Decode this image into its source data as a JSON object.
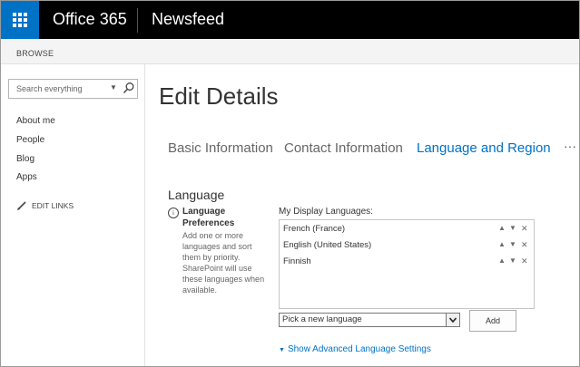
{
  "suite": {
    "title": "Office 365",
    "app": "Newsfeed",
    "accent": "#0072c6",
    "bar_color": "#000000"
  },
  "ribbon": {
    "browse_tab": "BROWSE"
  },
  "leftnav": {
    "search_placeholder": "Search everything",
    "search_caret": "▼",
    "items": [
      {
        "label": "About me"
      },
      {
        "label": "People"
      },
      {
        "label": "Blog"
      },
      {
        "label": "Apps"
      }
    ],
    "edit_links": "EDIT LINKS"
  },
  "main": {
    "title": "Edit Details",
    "tabs": [
      {
        "label": "Basic Information",
        "active": false
      },
      {
        "label": "Contact Information",
        "active": false
      },
      {
        "label": "Language and Region",
        "active": true
      }
    ],
    "tab_more": "···",
    "section": {
      "title": "Language",
      "info_icon": "i",
      "pref_title": "Language Preferences",
      "pref_desc": "Add one or more languages and sort them by priority. SharePoint will use these languages when available."
    },
    "display_languages": {
      "label": "My Display Languages:",
      "items": [
        {
          "name": "French (France)"
        },
        {
          "name": "English (United States)"
        },
        {
          "name": "Finnish"
        }
      ],
      "up_glyph": "▲",
      "down_glyph": "▼",
      "remove_glyph": "✕"
    },
    "picker": {
      "selected": "Pick a new language",
      "add_label": "Add"
    },
    "advanced_link": "Show Advanced Language Settings",
    "advanced_glyph": "▼"
  }
}
